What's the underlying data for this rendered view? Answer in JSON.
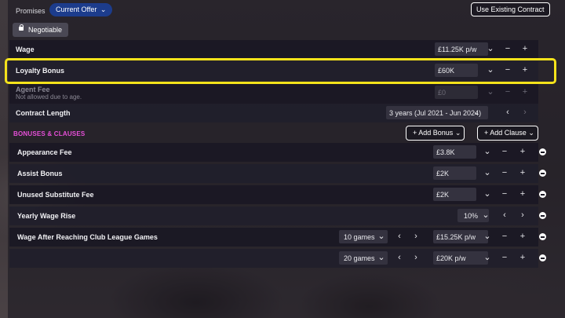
{
  "topbar": {
    "promises_label": "Promises",
    "offer_dropdown": "Current Offer",
    "use_existing_button": "Use Existing Contract",
    "negotiable_tag": "Negotiable"
  },
  "rows": {
    "wage": {
      "label": "Wage",
      "value": "£11.25K p/w"
    },
    "loyalty": {
      "label": "Loyalty Bonus",
      "value": "£60K"
    },
    "agent_fee": {
      "label": "Agent Fee",
      "note": "Not allowed due to age.",
      "value": "£0"
    },
    "contract_length": {
      "label": "Contract Length",
      "value": "3 years (Jul 2021 - Jun 2024)"
    }
  },
  "bonuses": {
    "title": "BONUSES & CLAUSES",
    "add_bonus_button": "+ Add Bonus",
    "add_clause_button": "+ Add Clause",
    "appearance_fee": {
      "label": "Appearance Fee",
      "value": "£3.8K"
    },
    "assist_bonus": {
      "label": "Assist Bonus",
      "value": "£2K"
    },
    "unused_sub_fee": {
      "label": "Unused Substitute Fee",
      "value": "£2K"
    },
    "yearly_wage_rise": {
      "label": "Yearly Wage Rise",
      "value": "10%"
    },
    "wage_after_games": {
      "label": "Wage After Reaching Club League Games",
      "tiers": [
        {
          "games": "10 games",
          "value": "£15.25K p/w"
        },
        {
          "games": "20 games",
          "value": "£20K p/w"
        }
      ]
    }
  },
  "glyphs": {
    "chevron_down": "⌄",
    "chevron_left": "‹",
    "chevron_right": "›",
    "minus": "−",
    "plus": "+",
    "lock": "🔒"
  },
  "colors": {
    "accent_blue": "#1c3c8c",
    "highlight_yellow": "#f5e31b",
    "section_pink": "#e64fd8"
  }
}
